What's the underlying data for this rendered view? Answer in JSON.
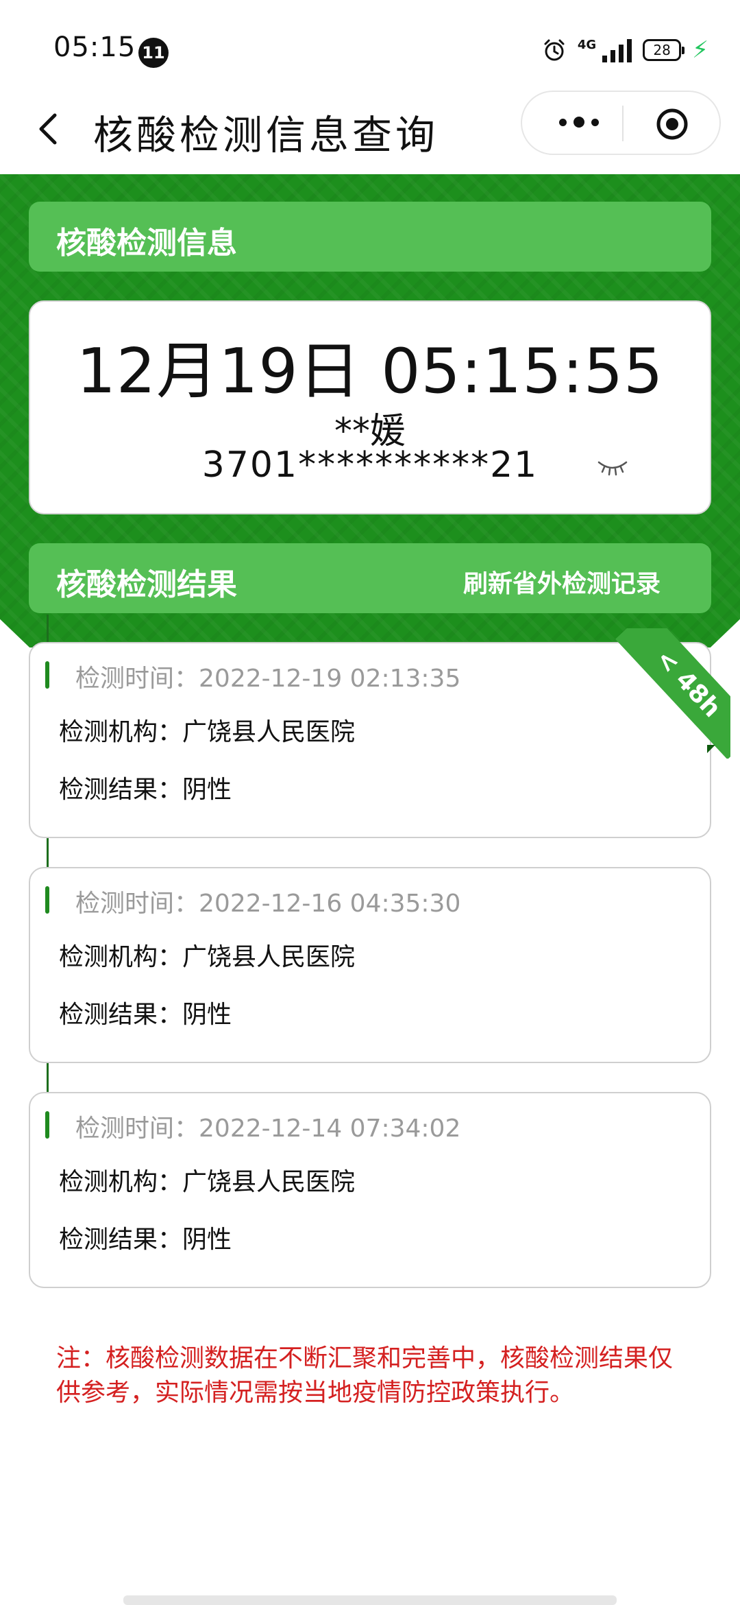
{
  "status_bar": {
    "time": "05:15",
    "notification_count": "11",
    "network": "4G",
    "battery": "28"
  },
  "nav": {
    "title": "核酸检测信息查询",
    "back_icon": "chevron-left-icon",
    "more_icon": "more-dots-icon",
    "close_icon": "target-circle-icon"
  },
  "info_section": {
    "label": "核酸检测信息"
  },
  "id_card": {
    "datetime": "12月19日 05:15:55",
    "name": "**媛",
    "id_number": "3701**********21",
    "eye_icon": "eye-closed-icon"
  },
  "result_section": {
    "label": "核酸检测结果",
    "refresh_label": "刷新省外检测记录"
  },
  "badge": {
    "text": "< 48h"
  },
  "records": [
    {
      "time_label": "检测时间：",
      "time_value": "2022-12-19 02:13:35",
      "org_line": "检测机构：广饶县人民医院",
      "result_line": "检测结果：阴性"
    },
    {
      "time_label": "检测时间：",
      "time_value": "2022-12-16 04:35:30",
      "org_line": "检测机构：广饶县人民医院",
      "result_line": "检测结果：阴性"
    },
    {
      "time_label": "检测时间：",
      "time_value": "2022-12-14 07:34:02",
      "org_line": "检测机构：广饶县人民医院",
      "result_line": "检测结果：阴性"
    }
  ],
  "note": {
    "text": "注：核酸检测数据在不断汇聚和完善中，核酸检测结果仅供参考，实际情况需按当地疫情防控政策执行。"
  },
  "colors": {
    "brand_green": "#1d8f1d",
    "bar_green": "#55bf55",
    "note_red": "#d42020",
    "badge_green": "#3aa83a"
  }
}
